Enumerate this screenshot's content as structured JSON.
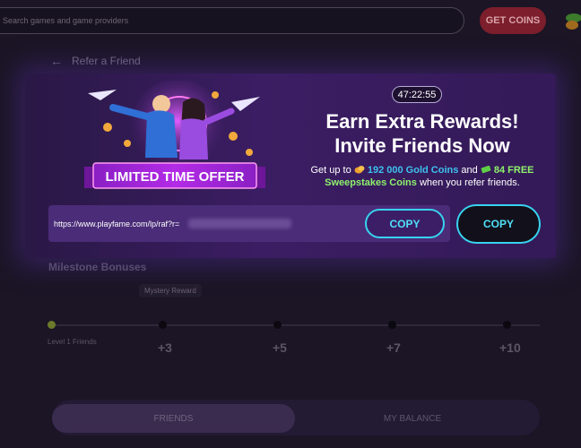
{
  "topbar": {
    "search_placeholder": "Search games and game providers",
    "get_coins_label": "GET COINS"
  },
  "breadcrumb": {
    "back_label": "Refer a Friend"
  },
  "promo": {
    "timer": "47:22:55",
    "headline_line1": "Earn Extra Rewards!",
    "headline_line2": "Invite Friends Now",
    "offer_prefix": "Get up to",
    "gold_amount": "192 000 Gold Coins",
    "offer_and": "and",
    "sweeps_amount": "84 FREE",
    "sweeps_label": "Sweepstakes Coins",
    "offer_suffix": "when you refer friends.",
    "banner_text": "LIMITED TIME OFFER"
  },
  "referral": {
    "link_prefix": "https://www.playfame.com/lp/raf?r=",
    "copy_inner_label": "COPY",
    "copy_outer_label": "COPY"
  },
  "milestones": {
    "title": "Milestone Bonuses",
    "mystery_label": "Mystery Reward",
    "level_label": "Level 1 Friends",
    "ticks": [
      "+3",
      "+5",
      "+7",
      "+10"
    ]
  },
  "tabs": {
    "friends_label": "FRIENDS",
    "balance_label": "MY BALANCE"
  },
  "colors": {
    "accent_cyan": "#37d3ee",
    "gold_text": "#3dc1ee",
    "sweeps_text": "#8ef26b",
    "panel_purple": "#3b1d63"
  }
}
